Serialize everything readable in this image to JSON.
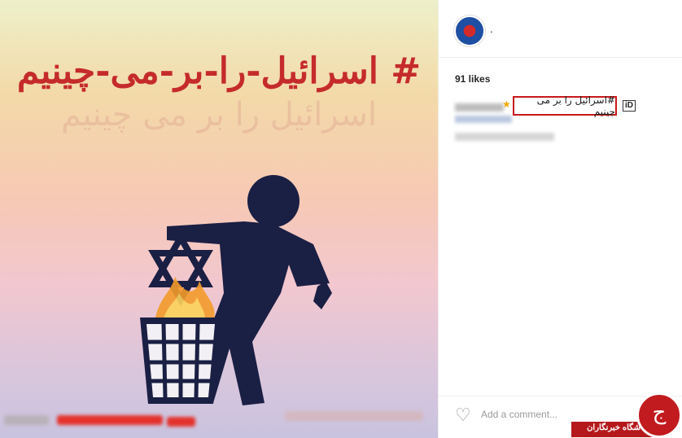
{
  "post": {
    "hashtag_text": "# اسرائیل-را-بر-می-چینیم"
  },
  "sidebar": {
    "username": ".",
    "likes": "91 likes",
    "caption_highlight": "#اسرائیل را بر می چینیم",
    "id_badge": "iD",
    "comment_placeholder": "Add a comment...",
    "more_dots": "···"
  },
  "watermark": {
    "label": "باشگاه خبرنگاران"
  },
  "icons": {
    "heart": "heart-icon",
    "avatar": "avatar",
    "star": "star-icon"
  }
}
